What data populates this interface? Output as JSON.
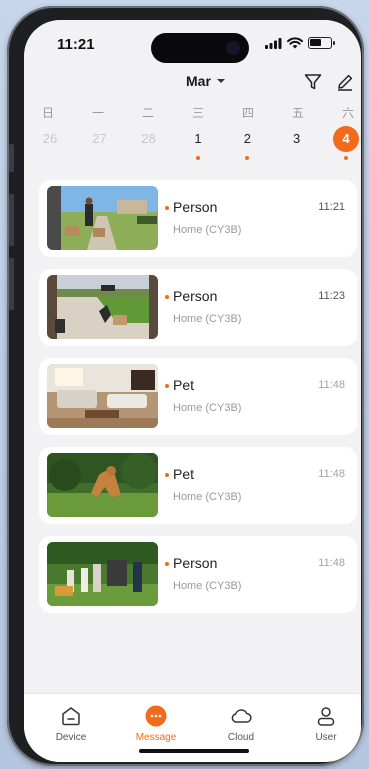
{
  "status_bar": {
    "time": "11:21"
  },
  "header": {
    "month": "Mar"
  },
  "calendar": {
    "weekdays": [
      "日",
      "一",
      "二",
      "三",
      "四",
      "五",
      "六"
    ],
    "dates": [
      {
        "num": "26",
        "faded": true,
        "dot": false
      },
      {
        "num": "27",
        "faded": true,
        "dot": false
      },
      {
        "num": "28",
        "faded": true,
        "dot": false
      },
      {
        "num": "1",
        "faded": false,
        "dot": true
      },
      {
        "num": "2",
        "faded": false,
        "dot": true
      },
      {
        "num": "3",
        "faded": false,
        "dot": false
      },
      {
        "num": "4",
        "faded": false,
        "dot": true,
        "selected": true
      }
    ]
  },
  "events": [
    {
      "type": "Person",
      "location": "Home (CY3B)",
      "time": "11:21"
    },
    {
      "type": "Person",
      "location": "Home (CY3B)",
      "time": "11:23"
    },
    {
      "type": "Pet",
      "location": "Home (CY3B)",
      "time": "11:48"
    },
    {
      "type": "Pet",
      "location": "Home (CY3B)",
      "time": "11:48"
    },
    {
      "type": "Person",
      "location": "Home (CY3B)",
      "time": "11:48"
    }
  ],
  "tabs": [
    {
      "label": "Device",
      "icon": "device-icon"
    },
    {
      "label": "Message",
      "icon": "message-icon",
      "active": true
    },
    {
      "label": "Cloud",
      "icon": "cloud-icon"
    },
    {
      "label": "User",
      "icon": "user-icon"
    }
  ],
  "colors": {
    "accent": "#f26a1b",
    "background": "#f2f2f4"
  }
}
